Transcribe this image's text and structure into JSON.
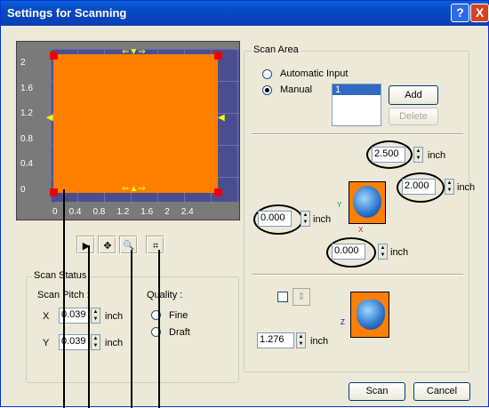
{
  "window": {
    "title": "Settings for Scanning",
    "help_glyph": "?",
    "close_glyph": "X"
  },
  "preview": {
    "y_ticks": [
      "2",
      "1.6",
      "1.2",
      "0.8",
      "0.4",
      "0"
    ],
    "x_ticks": [
      "0",
      "0.4",
      "0.8",
      "1.2",
      "1.6",
      "2",
      "2.4"
    ],
    "scan_area_color": "#ff7f00",
    "background_color": "#4a4e8f"
  },
  "tools": [
    {
      "icon": "pointer-icon",
      "glyph": "▶"
    },
    {
      "icon": "move-icon",
      "glyph": "✥"
    },
    {
      "icon": "zoom-icon",
      "glyph": "🔍"
    },
    {
      "icon": "fit-icon",
      "glyph": "⌗"
    }
  ],
  "scan_status": {
    "legend": "Scan Status",
    "pitch_label": "Scan Pitch :",
    "quality_label": "Quality :",
    "x_label": "X",
    "y_label": "Y",
    "x_value": "0.039",
    "y_value": "0.039",
    "unit": "inch",
    "fine_label": "Fine",
    "draft_label": "Draft"
  },
  "scan_area": {
    "legend": "Scan Area",
    "automatic_label": "Automatic Input",
    "manual_label": "Manual",
    "list_items": [
      "1"
    ],
    "add_label": "Add",
    "delete_label": "Delete",
    "width_value": "2.500",
    "depth_value": "2.000",
    "x_value": "0.000",
    "y_value": "0.000",
    "height_value": "1.276",
    "unit": "inch",
    "axis_y": "Y",
    "axis_x": "X",
    "axis_z": "Z"
  },
  "buttons": {
    "scan_label": "Scan",
    "cancel_label": "Cancel"
  }
}
